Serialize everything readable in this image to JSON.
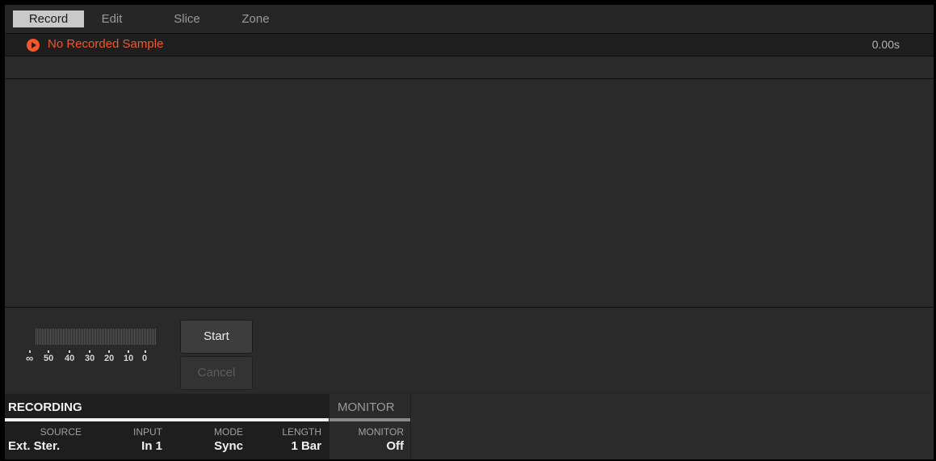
{
  "tabs": [
    {
      "label": "Record",
      "active": true
    },
    {
      "label": "Edit",
      "active": false
    },
    {
      "label": "Slice",
      "active": false
    },
    {
      "label": "Zone",
      "active": false
    }
  ],
  "sample": {
    "name": "No Recorded Sample",
    "length": "0.00s",
    "icon": "play-icon",
    "accent": "#f0582a"
  },
  "meter": {
    "scale": [
      "∞",
      "50",
      "40",
      "30",
      "20",
      "10",
      "0"
    ]
  },
  "buttons": {
    "start": "Start",
    "cancel": "Cancel"
  },
  "pages": {
    "recording": "RECORDING",
    "monitor": "MONITOR"
  },
  "params": [
    {
      "label": "SOURCE",
      "value": "Ext. Ster."
    },
    {
      "label": "INPUT",
      "value": "In 1"
    },
    {
      "label": "MODE",
      "value": "Sync"
    },
    {
      "label": "LENGTH",
      "value": "1 Bar"
    },
    {
      "label": "MONITOR",
      "value": "Off"
    }
  ]
}
